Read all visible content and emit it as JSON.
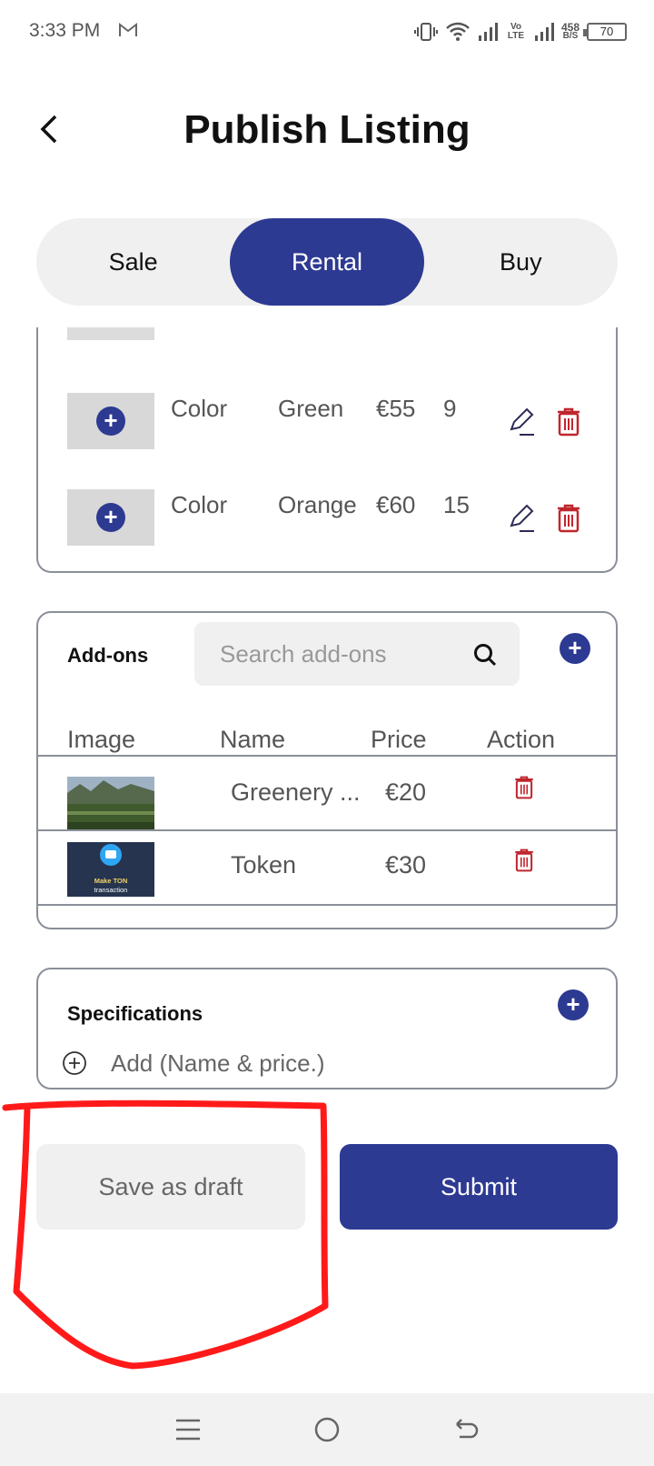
{
  "status_bar": {
    "time": "3:33 PM",
    "net_speed_value": "458",
    "net_speed_unit": "B/S",
    "network_label": "Vo LTE",
    "battery": "70"
  },
  "header": {
    "title": "Publish Listing"
  },
  "listing_type_tabs": [
    {
      "label": "Sale",
      "active": false
    },
    {
      "label": "Rental",
      "active": true
    },
    {
      "label": "Buy",
      "active": false
    }
  ],
  "variants": [
    {
      "attribute": "Color",
      "value": "Green",
      "price": "€55",
      "qty": "9"
    },
    {
      "attribute": "Color",
      "value": "Orange",
      "price": "€60",
      "qty": "15"
    }
  ],
  "addons": {
    "label": "Add-ons",
    "search_placeholder": "Search add-ons",
    "columns": [
      "Image",
      "Name",
      "Price",
      "Action"
    ],
    "rows": [
      {
        "name": "Greenery ...",
        "price": "€20",
        "image": "landscape-photo"
      },
      {
        "name": "Token",
        "price": "€30",
        "image": "token-wallet-image",
        "image_caption": "Make TON transaction"
      }
    ]
  },
  "specifications": {
    "label": "Specifications",
    "add_prompt": "Add (Name & price.)"
  },
  "actions": {
    "draft_label": "Save as draft",
    "submit_label": "Submit"
  },
  "colors": {
    "primary": "#2d3a92",
    "delete": "#c0262d",
    "annotation": "#ff1a1a"
  }
}
